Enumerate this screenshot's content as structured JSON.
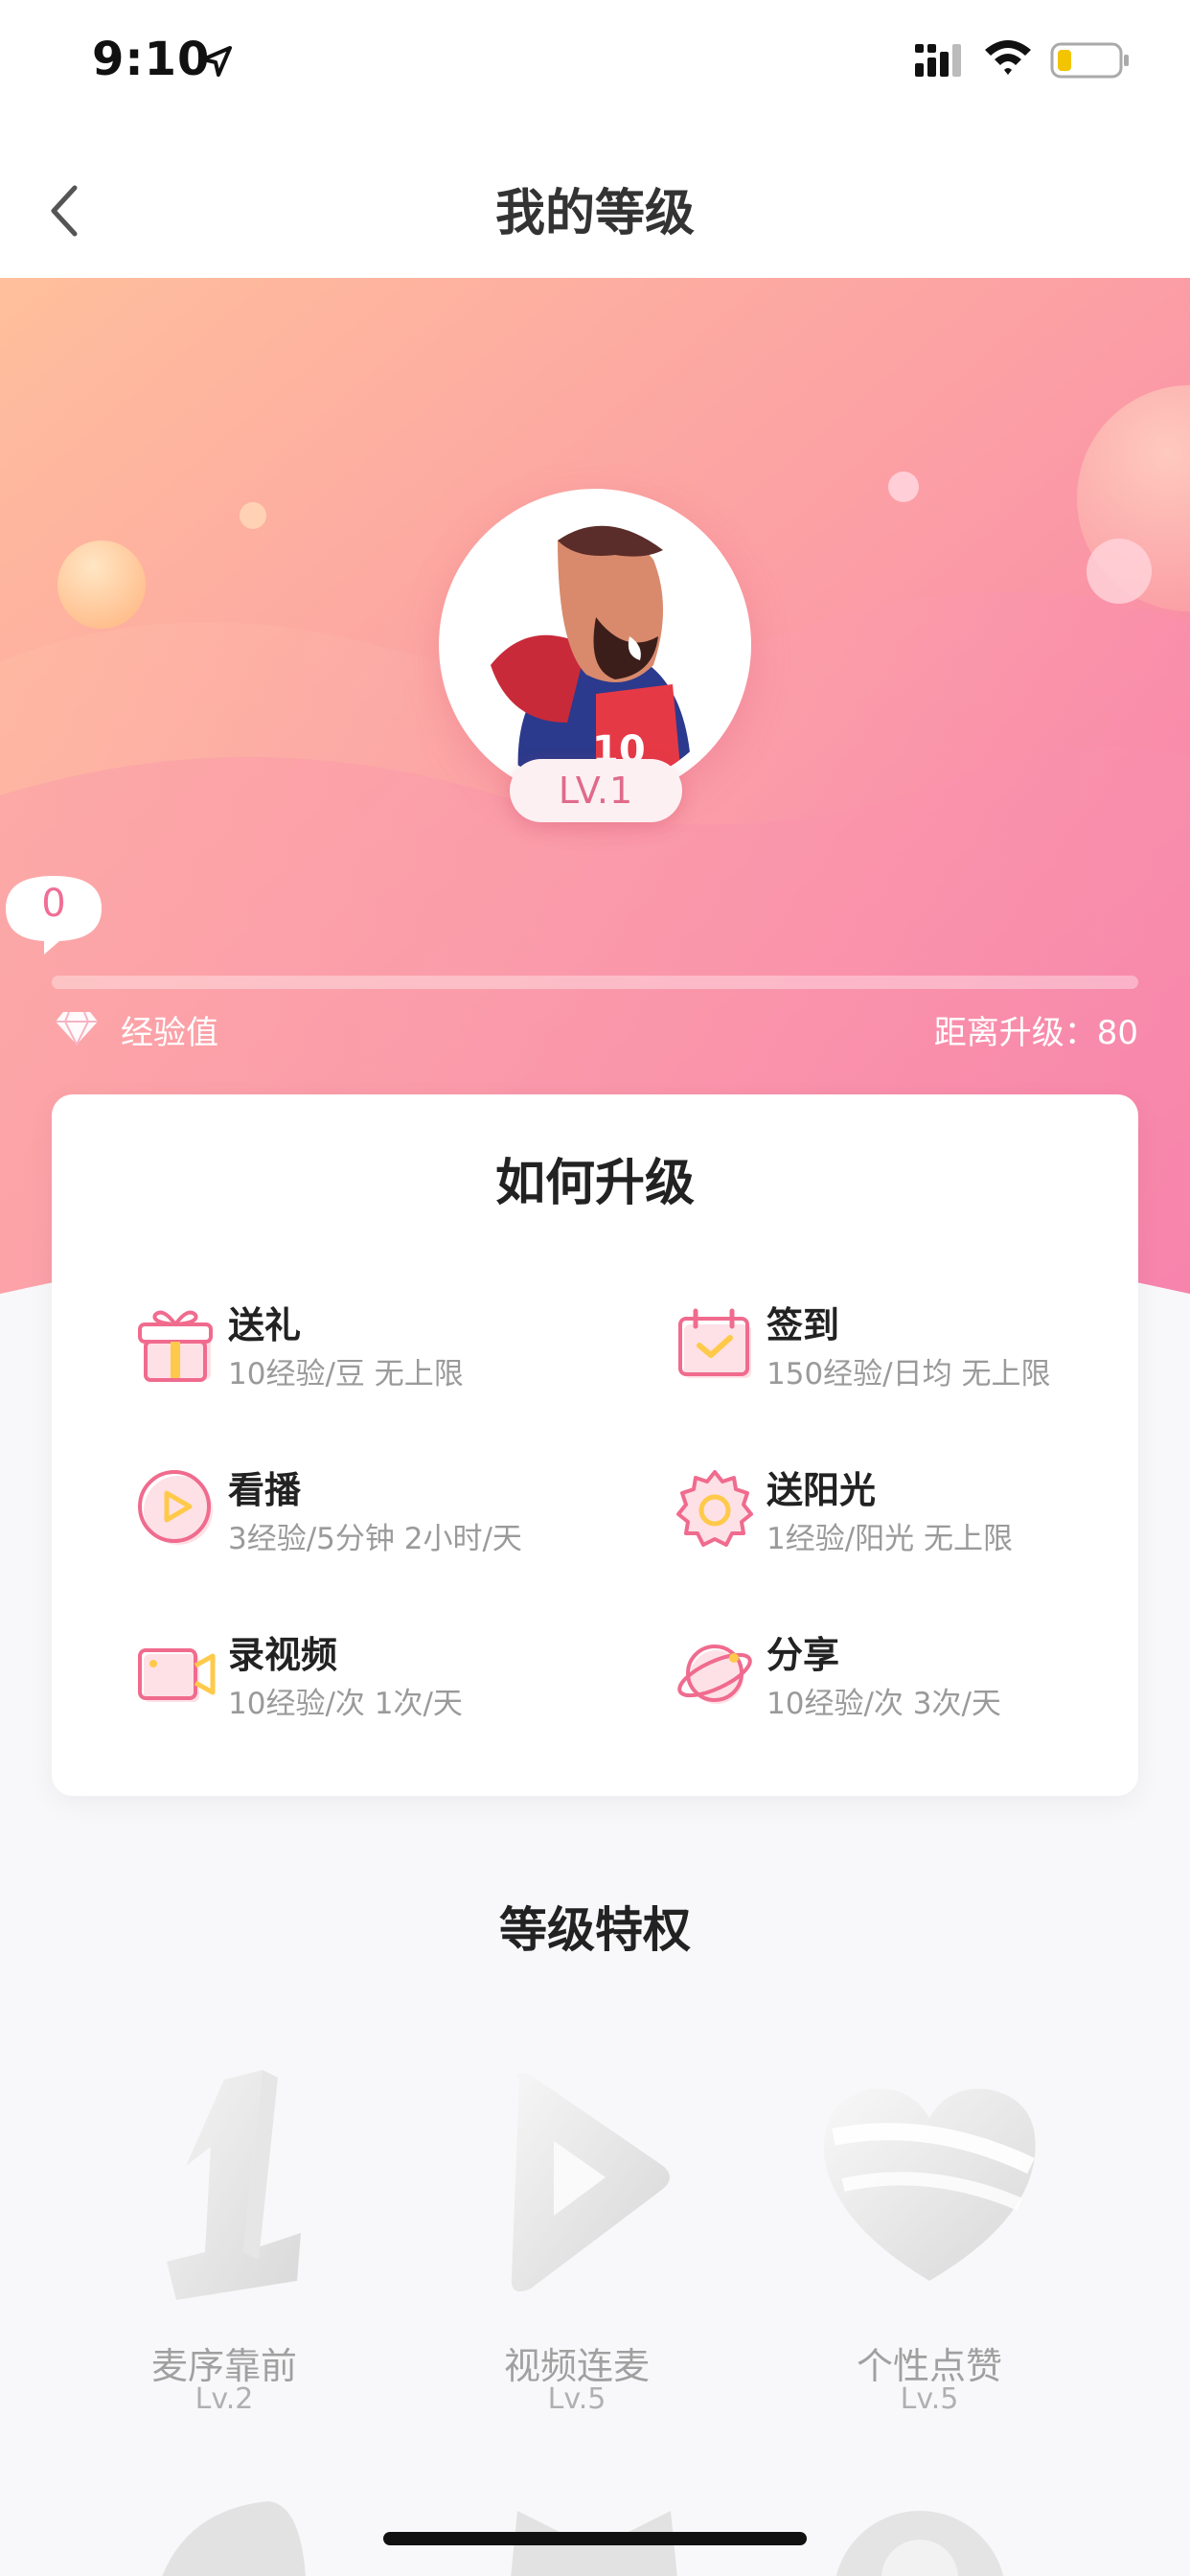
{
  "status_bar": {
    "time": "9:10"
  },
  "nav": {
    "title": "我的等级"
  },
  "profile": {
    "level_badge": "LV.1",
    "jersey_number": "10"
  },
  "experience": {
    "value": "0",
    "label": "经验值",
    "remaining": "距离升级：80"
  },
  "how_to_upgrade": {
    "title": "如何升级",
    "items": [
      {
        "name": "送礼",
        "desc": "10经验/豆 无上限",
        "icon": "gift-icon"
      },
      {
        "name": "签到",
        "desc": "150经验/日均 无上限",
        "icon": "calendar-check-icon"
      },
      {
        "name": "看播",
        "desc": "3经验/5分钟 2小时/天",
        "icon": "play-circle-icon"
      },
      {
        "name": "送阳光",
        "desc": "1经验/阳光 无上限",
        "icon": "sun-icon"
      },
      {
        "name": "录视频",
        "desc": "10经验/次 1次/天",
        "icon": "video-camera-icon"
      },
      {
        "name": "分享",
        "desc": "10经验/次 3次/天",
        "icon": "planet-icon"
      }
    ]
  },
  "privileges": {
    "title": "等级特权",
    "items": [
      {
        "name": "麦序靠前",
        "level": "Lv.2",
        "icon": "number-one-icon"
      },
      {
        "name": "视频连麦",
        "level": "Lv.5",
        "icon": "play-triangle-icon"
      },
      {
        "name": "个性点赞",
        "level": "Lv.5",
        "icon": "heart-icon"
      }
    ]
  },
  "colors": {
    "accent": "#ef6e96",
    "hero_start": "#ffbe9a",
    "hero_end": "#f77aa8"
  }
}
